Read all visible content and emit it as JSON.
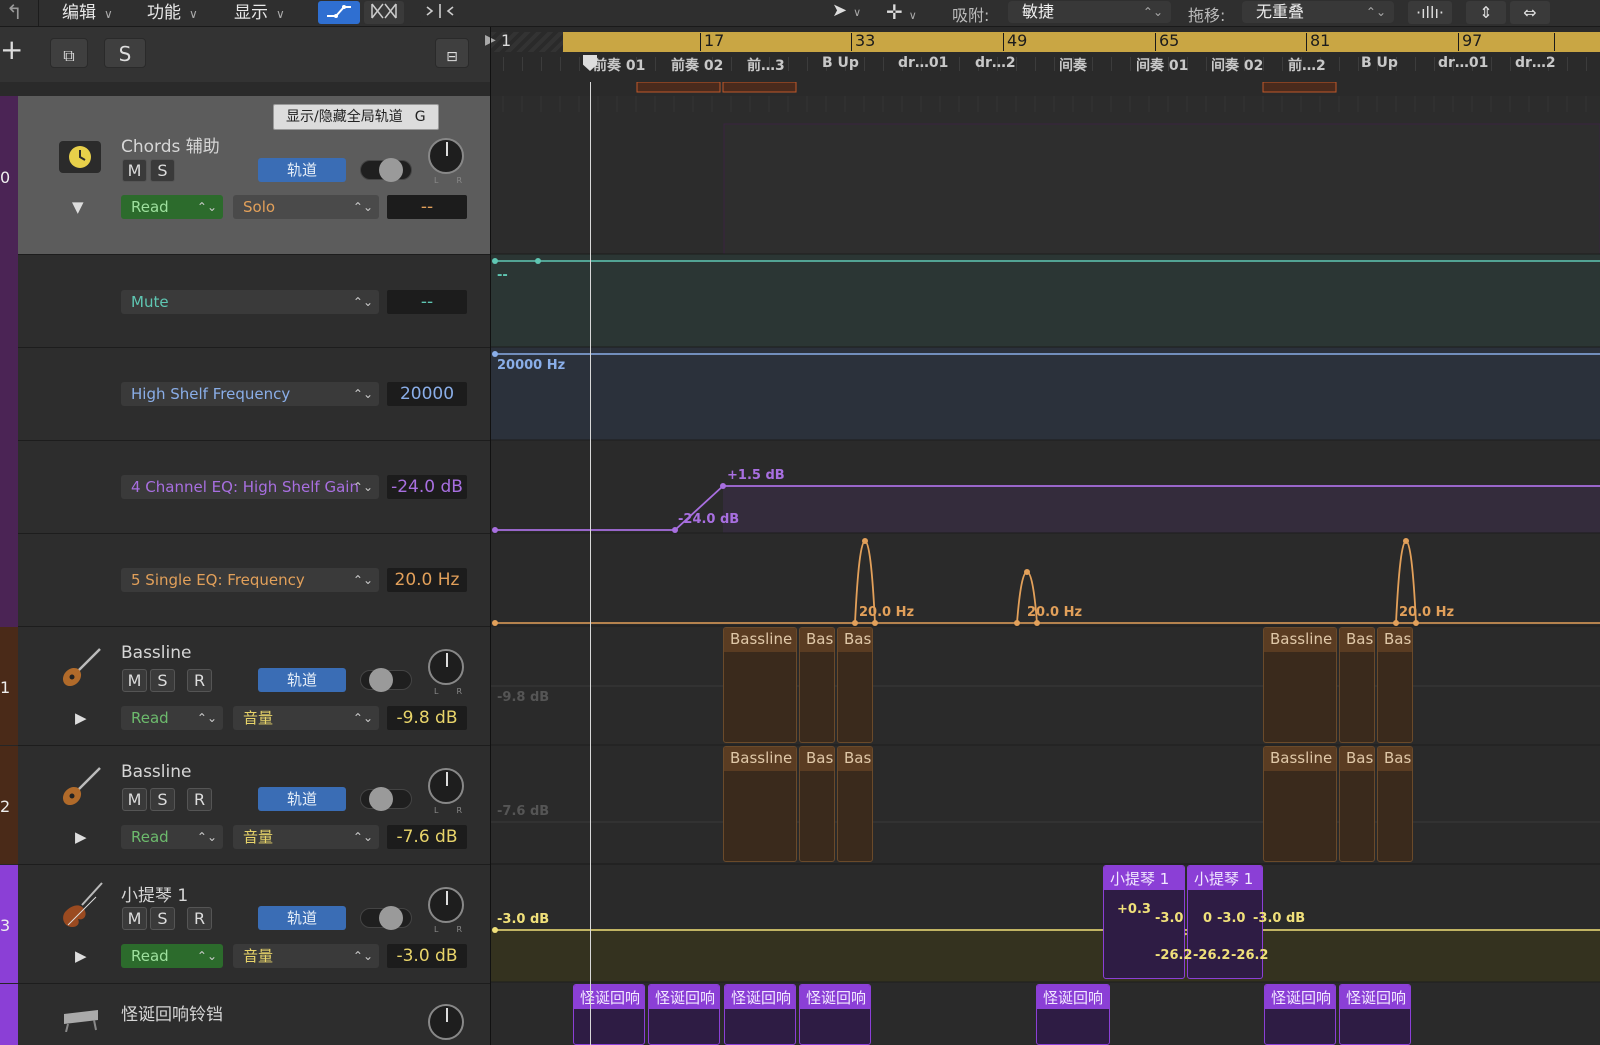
{
  "toolbar": {
    "back_icon": "back-arrow-icon",
    "menus": [
      "编辑",
      "功能",
      "显示"
    ],
    "snap_label": "吸附:",
    "snap_value": "敏捷",
    "drag_label": "拖移:",
    "drag_value": "无重叠"
  },
  "header": {
    "add_label": "+",
    "solo_label": "S"
  },
  "ruler": {
    "bars": [
      "1",
      "17",
      "33",
      "49",
      "65",
      "81",
      "97"
    ],
    "markers": [
      "前奏 01",
      "前奏 02",
      "前…3",
      "B Up",
      "dr…01",
      "dr…2",
      "间奏",
      "间奏 01",
      "间奏 02",
      "前…2",
      "B Up",
      "dr…01",
      "dr…2"
    ]
  },
  "tooltip": {
    "text": "显示/隐藏全局轨道",
    "key": "G"
  },
  "tracks": {
    "chords": {
      "number": "0",
      "name": "Chords 辅助",
      "m": "M",
      "s": "S",
      "track_btn": "轨道",
      "mode": "Read",
      "param": "Solo",
      "value": "--",
      "lanes": [
        {
          "param": "Mute",
          "value": "--"
        },
        {
          "param": "High Shelf Frequency",
          "value": "20000"
        },
        {
          "param": "4 Channel EQ: High Shelf Gain",
          "value": "-24.0 dB"
        },
        {
          "param": "5 Single EQ: Frequency",
          "value": "20.0 Hz"
        }
      ]
    },
    "bass1": {
      "number": "1",
      "name": "Bassline",
      "m": "M",
      "s": "S",
      "r": "R",
      "track_btn": "轨道",
      "mode": "Read",
      "param": "音量",
      "value": "-9.8 dB"
    },
    "bass2": {
      "number": "2",
      "name": "Bassline",
      "m": "M",
      "s": "S",
      "r": "R",
      "track_btn": "轨道",
      "mode": "Read",
      "param": "音量",
      "value": "-7.6 dB"
    },
    "violin": {
      "number": "3",
      "name": "小提琴 1",
      "m": "M",
      "s": "S",
      "r": "R",
      "track_btn": "轨道",
      "mode": "Read",
      "param": "音量",
      "value": "-3.0 dB"
    },
    "bells": {
      "name": "怪诞回响铃铛"
    }
  },
  "arrangement": {
    "mute_lane_value": "--",
    "freq_lane_value": "20000 Hz",
    "gain_low": "-24.0 dB",
    "gain_high": "+1.5 dB",
    "single_eq_labels": [
      "20.0 Hz",
      "20.0 Hz",
      "20.0 Hz"
    ],
    "bass1_level": "-9.8 dB",
    "bass2_level": "-7.6 dB",
    "violin_level": "-3.0 dB",
    "bass_region_labels": [
      "Bassline",
      "Bas",
      "Bas",
      "Bassline",
      "Bas",
      "Bas"
    ],
    "violin_regions": [
      "小提琴 1",
      "小提琴 1"
    ],
    "violin_auto_labels": [
      "+0.3",
      "-3.0",
      "0",
      "-3.0",
      "-3.0 dB"
    ],
    "violin_auto_low_labels": [
      "-26.2",
      "-26.2",
      "-26.2"
    ],
    "bells_regions": [
      "怪诞回响",
      "怪诞回响",
      "怪诞回响",
      "怪诞回响",
      "怪诞回响",
      "怪诞回响",
      "怪诞回响"
    ]
  },
  "colors": {
    "ruler_gold": "#c9a644",
    "mute_teal": "#5fc7b3",
    "freq_blue": "#8aaee8",
    "gain_purple": "#a86fe0",
    "eq_orange": "#e2a05a",
    "bass_brown": "#3a2a1c",
    "violin_purple": "#8b3fd6",
    "violin_auto_yellow": "#f0e07a",
    "track_button_blue": "#3a6db5"
  }
}
